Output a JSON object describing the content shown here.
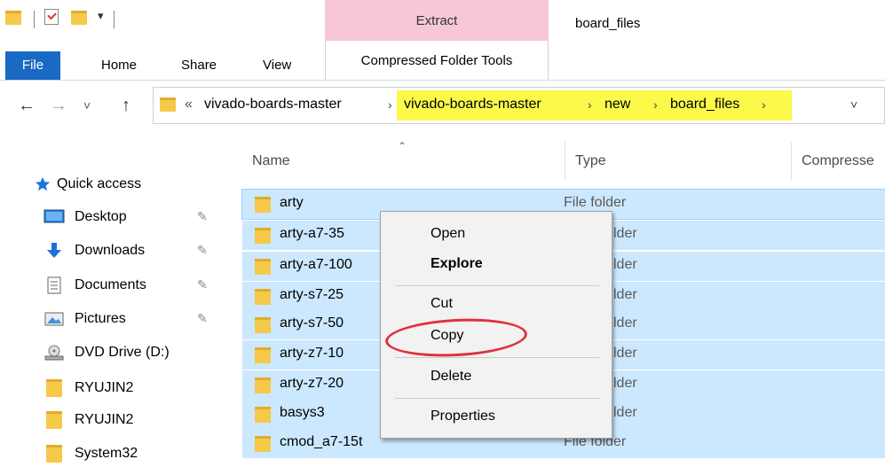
{
  "titlebar": {
    "title": "board_files",
    "context_tab": "Extract",
    "quick_access_icons": [
      "folder-icon",
      "properties-check-icon",
      "new-folder-icon",
      "customize-dropdown-icon"
    ]
  },
  "ribbon": {
    "tabs": [
      "File",
      "Home",
      "Share",
      "View",
      "Compressed Folder Tools"
    ]
  },
  "address": {
    "nav": {
      "back": "←",
      "forward": "→",
      "recent": "˅",
      "up": "↑"
    },
    "overflow": "«",
    "crumbs": [
      "vivado-boards-master",
      "vivado-boards-master",
      "new",
      "board_files"
    ],
    "separator": "›",
    "dropdown": "˅"
  },
  "sidebar": {
    "items": [
      {
        "label": "Quick access",
        "icon": "star-icon",
        "pinned": false
      },
      {
        "label": "Desktop",
        "icon": "desktop-icon",
        "pinned": true
      },
      {
        "label": "Downloads",
        "icon": "download-arrow-icon",
        "pinned": true
      },
      {
        "label": "Documents",
        "icon": "documents-icon",
        "pinned": true
      },
      {
        "label": "Pictures",
        "icon": "pictures-icon",
        "pinned": true
      },
      {
        "label": "DVD Drive (D:)",
        "icon": "dvd-drive-icon",
        "pinned": false
      },
      {
        "label": "RYUJIN2",
        "icon": "folder-icon",
        "pinned": false
      },
      {
        "label": "RYUJIN2",
        "icon": "folder-icon",
        "pinned": false
      },
      {
        "label": "System32",
        "icon": "folder-icon",
        "pinned": false
      }
    ],
    "pin_glyph": "📌"
  },
  "list": {
    "columns": [
      "Name",
      "Type",
      "Compresse"
    ],
    "rows": [
      {
        "name": "arty",
        "type": "File folder"
      },
      {
        "name": "arty-a7-35",
        "type": "File folder"
      },
      {
        "name": "arty-a7-100",
        "type": "File folder"
      },
      {
        "name": "arty-s7-25",
        "type": "File folder"
      },
      {
        "name": "arty-s7-50",
        "type": "File folder"
      },
      {
        "name": "arty-z7-10",
        "type": "File folder"
      },
      {
        "name": "arty-z7-20",
        "type": "File folder"
      },
      {
        "name": "basys3",
        "type": "File folder"
      },
      {
        "name": "cmod_a7-15t",
        "type": "File folder"
      }
    ],
    "visible_type_fragments": [
      "File folder",
      "lder",
      "lder",
      "lder",
      "lder",
      "lder",
      "lder",
      "lder",
      "File folder"
    ]
  },
  "context_menu": {
    "items": {
      "open": "Open",
      "explore": "Explore",
      "cut": "Cut",
      "copy": "Copy",
      "delete": "Delete",
      "properties": "Properties"
    },
    "highlight_color": "#e0303c"
  },
  "colors": {
    "file_tab": "#1a69c4",
    "selection": "#cce8ff",
    "extract_tab": "#f7c6d7",
    "address_highlight": "#fbf94a"
  }
}
